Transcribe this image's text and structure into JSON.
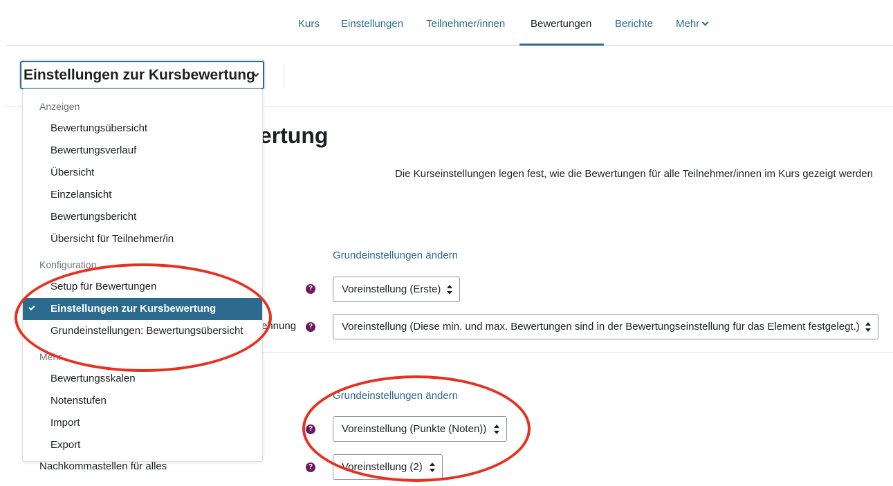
{
  "nav": {
    "tabs": [
      {
        "label": "Kurs"
      },
      {
        "label": "Einstellungen"
      },
      {
        "label": "Teilnehmer/innen"
      },
      {
        "label": "Bewertungen"
      },
      {
        "label": "Berichte"
      },
      {
        "label": "Mehr"
      }
    ]
  },
  "selector": {
    "label": "Einstellungen zur Kursbewertung"
  },
  "menu": {
    "sections": [
      {
        "header": "Anzeigen",
        "items": [
          "Bewertungsübersicht",
          "Bewertungsverlauf",
          "Übersicht",
          "Einzelansicht",
          "Bewertungsbericht",
          "Übersicht für Teilnehmer/in"
        ]
      },
      {
        "header": "Konfiguration",
        "items": [
          "Setup für Bewertungen",
          "Einstellungen zur Kursbewertung",
          "Grundeinstellungen: Bewertungsübersicht"
        ]
      },
      {
        "header": "Mehr",
        "items": [
          "Bewertungsskalen",
          "Notenstufen",
          "Import",
          "Export"
        ]
      }
    ],
    "active_item": "Einstellungen zur Kursbewertung"
  },
  "page": {
    "title_visible": "wertung",
    "description": "Die Kurseinstellungen legen fest, wie die Bewertungen für alle Teilnehmer/innen im Kurs gezeigt werden",
    "link1": "Grundeinstellungen ändern",
    "link2": "Grundeinstellungen ändern",
    "select1": "Voreinstellung (Erste)",
    "label2_visible": "ehnung",
    "select2": "Voreinstellung (Diese min. und max. Bewertungen sind in der Bewertungseinstellung für das Element festgelegt.)",
    "select3": "Voreinstellung (Punkte (Noten))",
    "label4": "Nachkommastellen für alles",
    "select4": "Voreinstellung (2)",
    "help_glyph": "?"
  },
  "colors": {
    "accent": "#2c6a8e",
    "help": "#6b1a5e",
    "annotation": "#e8301f"
  }
}
